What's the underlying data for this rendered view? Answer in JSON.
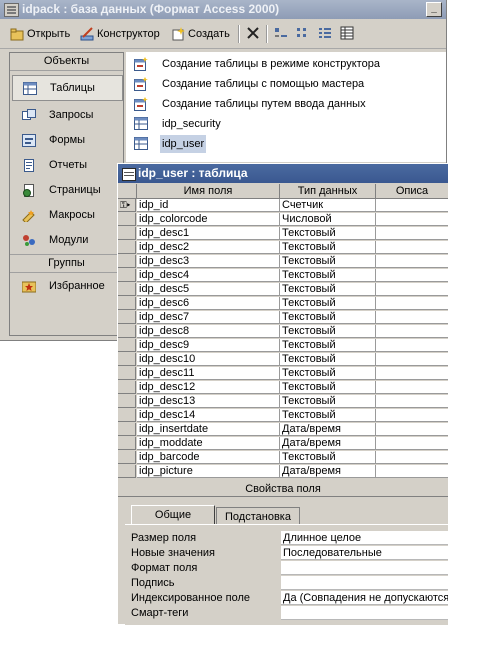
{
  "db_window": {
    "title": "idpack : база данных (Формат Access 2000)",
    "toolbar": {
      "open": "Открыть",
      "design": "Конструктор",
      "create": "Создать"
    }
  },
  "objects_bar": {
    "header": "Объекты",
    "items": [
      {
        "label": "Таблицы",
        "icon": "table-icon"
      },
      {
        "label": "Запросы",
        "icon": "query-icon"
      },
      {
        "label": "Формы",
        "icon": "form-icon"
      },
      {
        "label": "Отчеты",
        "icon": "report-icon"
      },
      {
        "label": "Страницы",
        "icon": "page-icon"
      },
      {
        "label": "Макросы",
        "icon": "macro-icon"
      },
      {
        "label": "Модули",
        "icon": "module-icon"
      }
    ],
    "groups_header": "Группы",
    "favorites": "Избранное"
  },
  "object_list": [
    {
      "label": "Создание таблицы в режиме конструктора",
      "icon": "wizard-icon"
    },
    {
      "label": "Создание таблицы с помощью мастера",
      "icon": "wizard-icon"
    },
    {
      "label": "Создание таблицы путем ввода данных",
      "icon": "wizard-icon"
    },
    {
      "label": "idp_security",
      "icon": "table-icon"
    },
    {
      "label": "idp_user",
      "icon": "table-icon"
    }
  ],
  "table_window": {
    "title": "idp_user : таблица",
    "columns": [
      "Имя поля",
      "Тип данных",
      "Описа"
    ],
    "rows": [
      {
        "name": "idp_id",
        "type": "Счетчик",
        "key": true
      },
      {
        "name": "idp_colorcode",
        "type": "Числовой"
      },
      {
        "name": "idp_desc1",
        "type": "Текстовый"
      },
      {
        "name": "idp_desc2",
        "type": "Текстовый"
      },
      {
        "name": "idp_desc3",
        "type": "Текстовый"
      },
      {
        "name": "idp_desc4",
        "type": "Текстовый"
      },
      {
        "name": "idp_desc5",
        "type": "Текстовый"
      },
      {
        "name": "idp_desc6",
        "type": "Текстовый"
      },
      {
        "name": "idp_desc7",
        "type": "Текстовый"
      },
      {
        "name": "idp_desc8",
        "type": "Текстовый"
      },
      {
        "name": "idp_desc9",
        "type": "Текстовый"
      },
      {
        "name": "idp_desc10",
        "type": "Текстовый"
      },
      {
        "name": "idp_desc11",
        "type": "Текстовый"
      },
      {
        "name": "idp_desc12",
        "type": "Текстовый"
      },
      {
        "name": "idp_desc13",
        "type": "Текстовый"
      },
      {
        "name": "idp_desc14",
        "type": "Текстовый"
      },
      {
        "name": "idp_insertdate",
        "type": "Дата/время"
      },
      {
        "name": "idp_moddate",
        "type": "Дата/время"
      },
      {
        "name": "idp_barcode",
        "type": "Текстовый"
      },
      {
        "name": "idp_picture",
        "type": "Дата/время"
      }
    ],
    "properties_caption": "Свойства поля",
    "tabs": [
      "Общие",
      "Подстановка"
    ],
    "properties": [
      {
        "label": "Размер поля",
        "value": "Длинное целое"
      },
      {
        "label": "Новые значения",
        "value": "Последовательные"
      },
      {
        "label": "Формат поля",
        "value": ""
      },
      {
        "label": "Подпись",
        "value": ""
      },
      {
        "label": "Индексированное поле",
        "value": "Да (Совпадения не допускаются)"
      },
      {
        "label": "Смарт-теги",
        "value": ""
      }
    ]
  }
}
